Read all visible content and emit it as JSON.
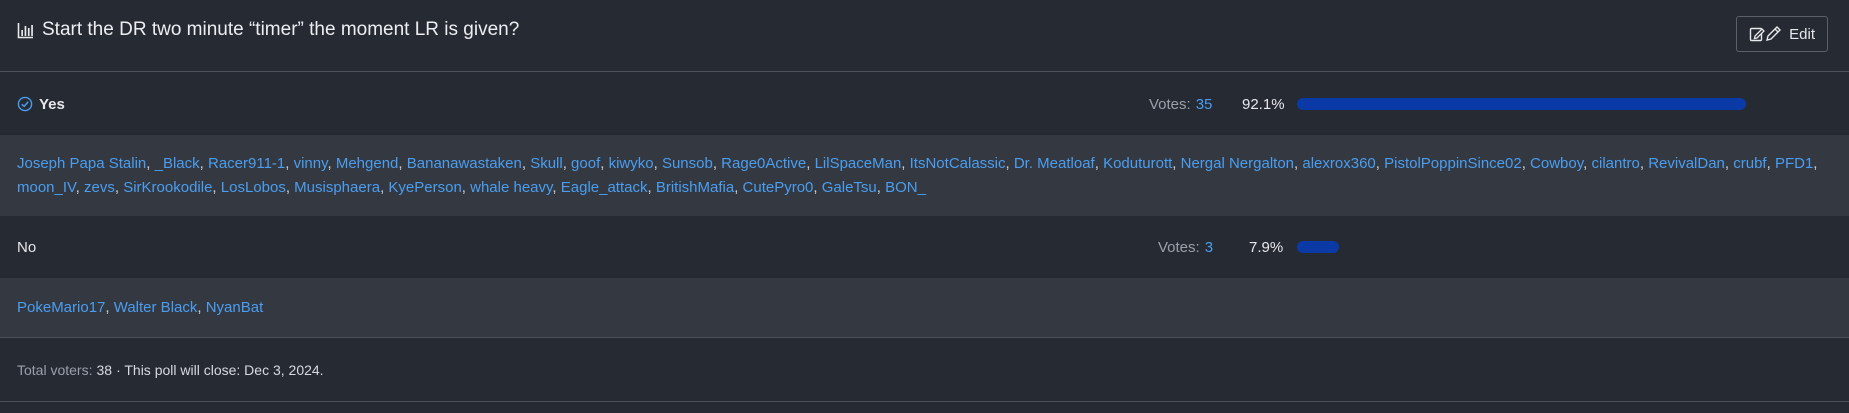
{
  "poll": {
    "title": "Start the DR two minute “timer” the moment LR is given?",
    "edit_label": "Edit",
    "options": [
      {
        "label": "Yes",
        "selected": true,
        "votes_label": "Votes:",
        "votes": "35",
        "percent_text": "92.1%",
        "percent": 92.1,
        "voters": [
          "Joseph Papa Stalin",
          "_Black",
          "Racer911-1",
          "vinny",
          "Mehgend",
          "Bananawastaken",
          "Skull",
          "goof",
          "kiwyko",
          "Sunsob",
          "Rage0Active",
          "LilSpaceMan",
          "ItsNotCalassic",
          "Dr. Meatloaf",
          "Koduturott",
          "Nergal Nergalton",
          "alexrox360",
          "PistolPoppinSince02",
          "Cowboy",
          "cilantro",
          "RevivalDan",
          "crubf",
          "PFD1",
          "moon_IV",
          "zevs",
          "SirKrookodile",
          "LosLobos",
          "Musisphaera",
          "KyePerson",
          "whale heavy",
          "Eagle_attack",
          "BritishMafia",
          "CutePyro0",
          "GaleTsu",
          "BON_"
        ]
      },
      {
        "label": "No",
        "selected": false,
        "votes_label": "Votes:",
        "votes": "3",
        "percent_text": "7.9%",
        "percent": 7.9,
        "voters": [
          "PokeMario17",
          "Walter Black",
          "NyanBat"
        ]
      }
    ],
    "footer": {
      "total_label": "Total voters:",
      "total": "38",
      "close_text": "· This poll will close: Dec 3, 2024."
    }
  },
  "colors": {
    "background": "#262a33",
    "voters_background": "#343941",
    "link": "#4a9df0",
    "bar": "#0b3aa6"
  },
  "icons": {
    "title_icon": "bar-chart-icon",
    "edit_icon": "edit-icon",
    "selected_icon": "check-circle-icon"
  }
}
